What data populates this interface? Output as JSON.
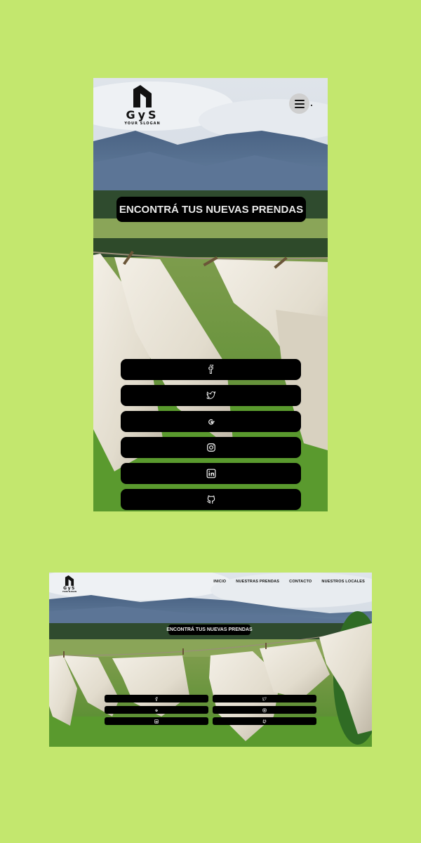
{
  "brand": {
    "name": "GyS",
    "slogan": "YOUR SLOGAN"
  },
  "hero": {
    "title": "ENCONTRÁ TUS NUEVAS PRENDAS"
  },
  "nav": {
    "items": [
      {
        "label": "INICIO"
      },
      {
        "label": "NUESTRAS PRENDAS"
      },
      {
        "label": "CONTACTO"
      },
      {
        "label": "NUESTROS LOCALES"
      }
    ]
  },
  "social": {
    "icons": [
      "facebook-icon",
      "twitter-icon",
      "google-icon",
      "instagram-icon",
      "linkedin-icon",
      "github-icon"
    ]
  },
  "colors": {
    "page_background": "#c3e76e",
    "button_background": "#000000",
    "button_text": "#e8e8e8",
    "menu_button": "#cfcfcf"
  }
}
